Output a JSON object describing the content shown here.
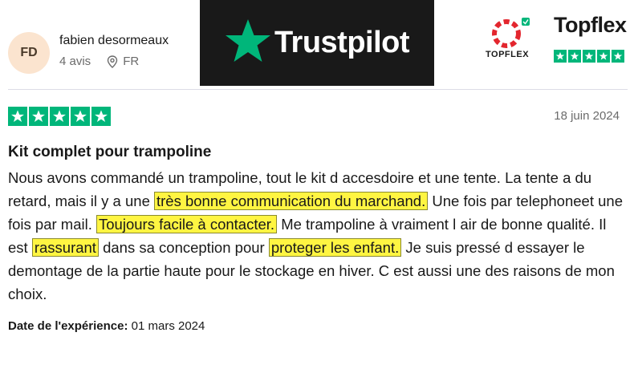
{
  "reviewer": {
    "initials": "FD",
    "name": "fabien desormeaux",
    "reviews_count": "4 avis",
    "country": "FR"
  },
  "branding": {
    "trustpilot_label": "Trustpilot",
    "topflex_mark_label": "TOPFLEX",
    "topflex_wordmark": "Topflex",
    "trustpilot_green": "#00b67a"
  },
  "review": {
    "rating": 5,
    "date": "18 juin 2024",
    "title": "Kit complet pour trampoline",
    "body_segments": [
      {
        "text": "Nous avons commandé un trampoline, tout le kit d accesdoire et une tente. La tente a du retard, mais il y a une ",
        "highlight": false
      },
      {
        "text": "très bonne communication du marchand.",
        "highlight": true
      },
      {
        "text": " Une fois par telephoneet une fois par mail. ",
        "highlight": false
      },
      {
        "text": "Toujours facile à contacter.",
        "highlight": true
      },
      {
        "text": " Me trampoline à vraiment l air de bonne qualité. Il est ",
        "highlight": false
      },
      {
        "text": "rassurant",
        "highlight": true
      },
      {
        "text": " dans sa conception pour ",
        "highlight": false
      },
      {
        "text": "proteger les enfant.",
        "highlight": true
      },
      {
        "text": " Je suis pressé d essayer le demontage de la partie haute pour le stockage en hiver. C est aussi une des raisons de mon choix.",
        "highlight": false
      }
    ],
    "experience_label": "Date de l'expérience:",
    "experience_date": "01 mars 2024"
  }
}
